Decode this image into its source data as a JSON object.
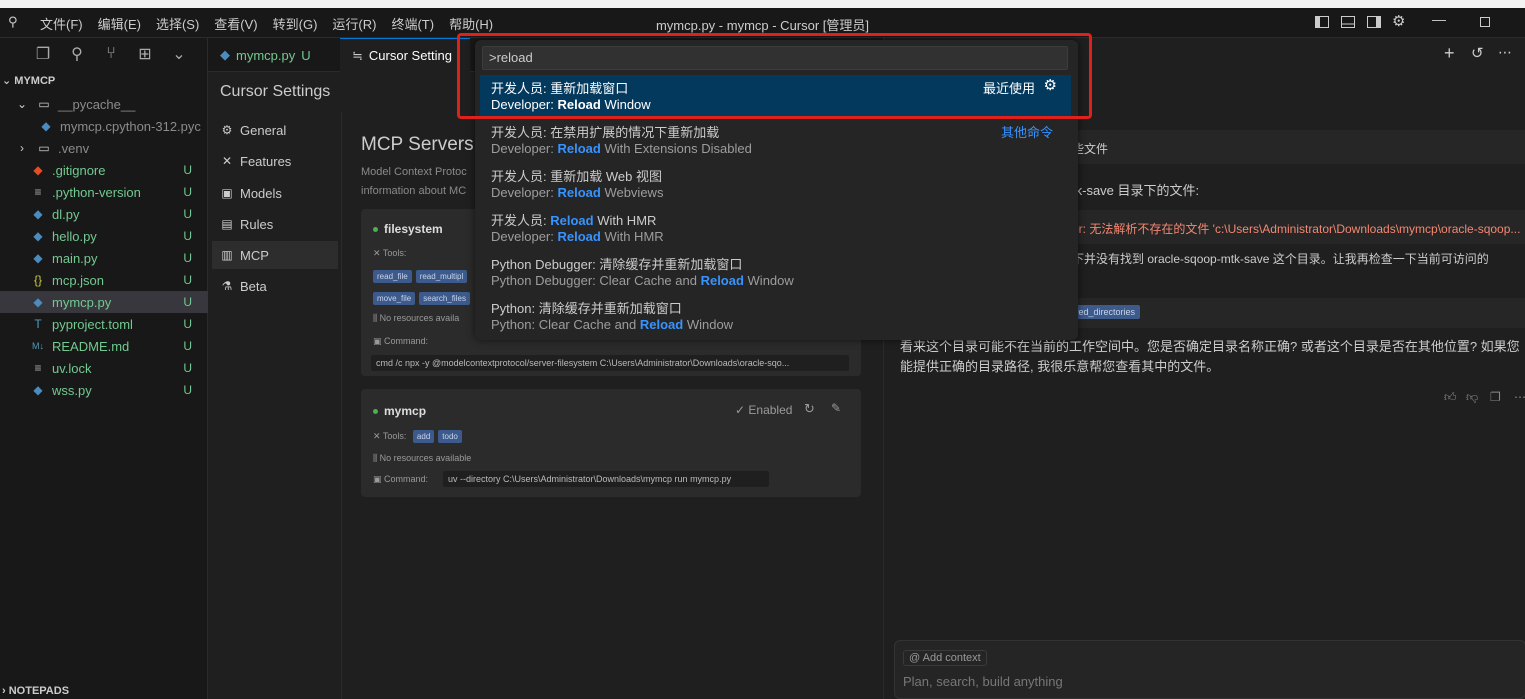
{
  "titlebar": {
    "menu": [
      "文件(F)",
      "编辑(E)",
      "选择(S)",
      "查看(V)",
      "转到(G)",
      "运行(R)",
      "终端(T)",
      "帮助(H)"
    ],
    "window_title": "mymcp.py - mymcp - Cursor [管理员]"
  },
  "explorer": {
    "section": "MYMCP",
    "items": [
      {
        "name": "__pycache__",
        "icon": "folder-icon",
        "status": ""
      },
      {
        "name": "mymcp.cpython-312.pyc",
        "icon": "python-icon",
        "status": ""
      },
      {
        "name": ".venv",
        "icon": "folder-icon",
        "status": ""
      },
      {
        "name": ".gitignore",
        "icon": "git-icon",
        "status": "U"
      },
      {
        "name": ".python-version",
        "icon": "lines-icon",
        "status": "U"
      },
      {
        "name": "dl.py",
        "icon": "python-icon",
        "status": "U"
      },
      {
        "name": "hello.py",
        "icon": "python-icon",
        "status": "U"
      },
      {
        "name": "main.py",
        "icon": "python-icon",
        "status": "U"
      },
      {
        "name": "mcp.json",
        "icon": "json-icon",
        "status": "U"
      },
      {
        "name": "mymcp.py",
        "icon": "python-icon",
        "status": "U"
      },
      {
        "name": "pyproject.toml",
        "icon": "toml-icon",
        "status": "U"
      },
      {
        "name": "README.md",
        "icon": "markdown-icon",
        "status": "U"
      },
      {
        "name": "uv.lock",
        "icon": "lines-icon",
        "status": "U"
      },
      {
        "name": "wss.py",
        "icon": "python-icon",
        "status": "U"
      }
    ],
    "notepads": "NOTEPADS"
  },
  "tabs": {
    "tab1_name": "mymcp.py",
    "tab1_status": "U",
    "tab2_name": "Cursor Setting"
  },
  "settings": {
    "title": "Cursor Settings",
    "nav": [
      "General",
      "Features",
      "Models",
      "Rules",
      "MCP",
      "Beta"
    ],
    "mcp_heading": "MCP Servers",
    "desc_line1": "Model Context Protoc",
    "desc_line2": "information about MC",
    "server1": {
      "name": "filesystem",
      "tools_label": "Tools:",
      "tools_row1": [
        "read_file",
        "read_multipl"
      ],
      "tools_row2": [
        "move_file",
        "search_files"
      ],
      "resources": "No resources availa",
      "command_label": "Command:",
      "command": "cmd /c npx -y @modelcontextprotocol/server-filesystem C:\\Users\\Administrator\\Downloads\\oracle-sqo..."
    },
    "server2": {
      "name": "mymcp",
      "enabled": "Enabled",
      "tools_label": "Tools:",
      "tools": [
        "add",
        "todo"
      ],
      "resources": "No resources available",
      "command_label": "Command:",
      "command": "uv --directory C:\\Users\\Administrator\\Downloads\\mymcp run mymcp.py"
    }
  },
  "palette": {
    "input": ">reload",
    "items": [
      {
        "l1": "开发人员: 重新加载窗口",
        "l2_pre": "Developer: ",
        "l2_hl": "Reload",
        "l2_post": " Window",
        "right": "最近使用"
      },
      {
        "l1": "开发人员: 在禁用扩展的情况下重新加载",
        "l2_pre": "Developer: ",
        "l2_hl": "Reload",
        "l2_post": " With Extensions Disabled",
        "right": "其他命令"
      },
      {
        "l1": "开发人员: 重新加载 Web 视图",
        "l2_pre": "Developer: ",
        "l2_hl": "Reload",
        "l2_post": " Webviews",
        "right": ""
      },
      {
        "l1_pre": "开发人员: ",
        "l1_hl": "Reload",
        "l1_post": " With HMR",
        "l2_pre": "Developer: ",
        "l2_hl": "Reload",
        "l2_post": " With HMR",
        "right": ""
      },
      {
        "l1": "Python Debugger: 清除缓存并重新加载窗口",
        "l2_pre": "Python Debugger: Clear Cache and ",
        "l2_hl": "Reload",
        "l2_post": " Window",
        "right": ""
      },
      {
        "l1": "Python: 清除缓存并重新加载窗口",
        "l2_pre": "Python: Clear Cache and ",
        "l2_hl": "Reload",
        "l2_post": " Window",
        "right": ""
      }
    ]
  },
  "chat": {
    "files_header": "些文件",
    "line1": "tk-save 目录下的文件:",
    "error": "or: 无法解析不存在的文件 'c:\\Users\\Administrator\\Downloads\\mymcp\\oracle-sqoop...",
    "line2": "下并没有找到 oracle-sqoop-mtk-save 这个目录。让我再检查一下当前可访问的",
    "allowed": "owed_directories",
    "para1": "看来这个目录可能不在当前的工作空间中。您是否确定目录名称正确? 或者这个目录是否在其他位置? 如果您",
    "para2": "能提供正确的目录路径, 我很乐意帮您查看其中的文件。",
    "add_context": "Add context",
    "placeholder": "Plan, search, build anything"
  },
  "colors": {
    "accent": "#3794ff",
    "untracked": "#73c991",
    "highlight_box": "#e0201b",
    "active_item": "#04395e"
  }
}
